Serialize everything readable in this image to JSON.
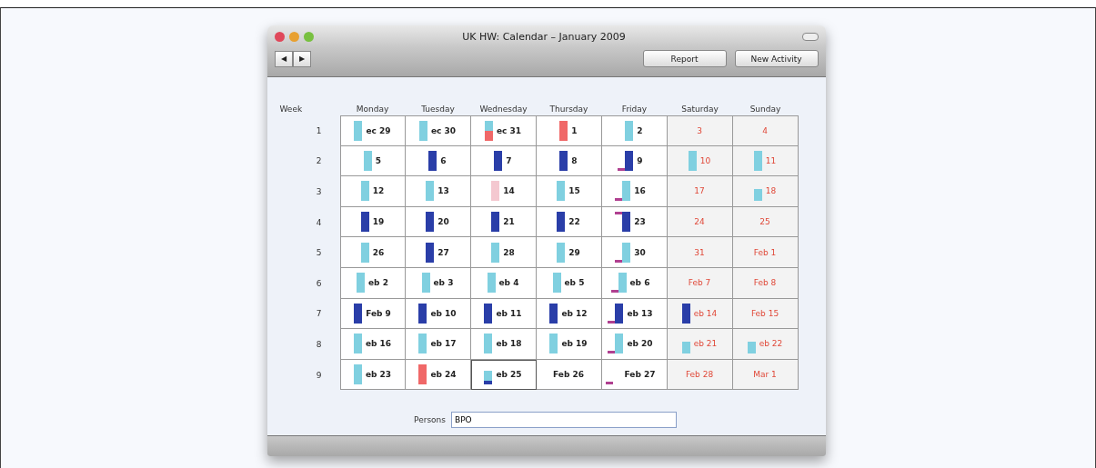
{
  "window": {
    "title": "UK HW: Calendar – January 2009"
  },
  "toolbar": {
    "nav": [
      "◀",
      "▶"
    ],
    "buttons": [
      "Report",
      "New Activity"
    ]
  },
  "calendar": {
    "week_heading": "Week",
    "days": [
      {
        "label": "Monday"
      },
      {
        "label": "Tuesday"
      },
      {
        "label": "Wednesday"
      },
      {
        "label": "Thursday"
      },
      {
        "label": "Friday"
      },
      {
        "label": "Saturday"
      },
      {
        "label": "Sunday"
      }
    ],
    "weeks": [
      {
        "number": "1",
        "cells": [
          {
            "label": "ec 29",
            "weekend": false,
            "selected": false,
            "bars": [
              {
                "kind": "full",
                "color": "#80d0e0"
              }
            ]
          },
          {
            "label": "ec 30",
            "weekend": false,
            "selected": false,
            "bars": [
              {
                "kind": "full",
                "color": "#80d0e0"
              }
            ]
          },
          {
            "label": "ec 31",
            "weekend": false,
            "selected": false,
            "bars": [
              {
                "kind": "half",
                "color": "#f06868"
              },
              {
                "kind": "half",
                "color": "#80d0e0"
              }
            ]
          },
          {
            "label": "1",
            "weekend": false,
            "selected": false,
            "bars": [
              {
                "kind": "full",
                "color": "#f06868"
              }
            ]
          },
          {
            "label": "2",
            "weekend": false,
            "selected": false,
            "bars": [
              {
                "kind": "full",
                "color": "#80d0e0"
              }
            ]
          },
          {
            "label": "3",
            "weekend": true,
            "selected": false
          },
          {
            "label": "4",
            "weekend": true,
            "selected": false
          }
        ]
      },
      {
        "number": "2",
        "cells": [
          {
            "label": "5",
            "weekend": false,
            "selected": false,
            "bars": [
              {
                "kind": "full",
                "color": "#80d0e0"
              }
            ]
          },
          {
            "label": "6",
            "weekend": false,
            "selected": false,
            "bars": [
              {
                "kind": "full",
                "color": "#2a3ea8"
              }
            ]
          },
          {
            "label": "7",
            "weekend": false,
            "selected": false,
            "bars": [
              {
                "kind": "full",
                "color": "#2a3ea8"
              }
            ]
          },
          {
            "label": "8",
            "weekend": false,
            "selected": false,
            "bars": [
              {
                "kind": "full",
                "color": "#2a3ea8"
              }
            ]
          },
          {
            "label": "9",
            "weekend": false,
            "selected": false,
            "markers": [
              {
                "kind": "low"
              }
            ],
            "bars": [
              {
                "kind": "full",
                "color": "#2a3ea8"
              }
            ]
          },
          {
            "label": "10",
            "weekend": true,
            "selected": false,
            "bars": [
              {
                "kind": "full",
                "color": "#80d0e0"
              }
            ]
          },
          {
            "label": "11",
            "weekend": true,
            "selected": false,
            "bars": [
              {
                "kind": "full",
                "color": "#80d0e0"
              }
            ]
          }
        ]
      },
      {
        "number": "3",
        "cells": [
          {
            "label": "12",
            "weekend": false,
            "selected": false,
            "bars": [
              {
                "kind": "full",
                "color": "#80d0e0"
              }
            ]
          },
          {
            "label": "13",
            "weekend": false,
            "selected": false,
            "bars": [
              {
                "kind": "full",
                "color": "#80d0e0"
              }
            ]
          },
          {
            "label": "14",
            "weekend": false,
            "selected": false,
            "bars": [
              {
                "kind": "full",
                "color": "#f4c8d0"
              }
            ]
          },
          {
            "label": "15",
            "weekend": false,
            "selected": false,
            "bars": [
              {
                "kind": "full",
                "color": "#80d0e0"
              }
            ]
          },
          {
            "label": "16",
            "weekend": false,
            "selected": false,
            "markers": [
              {
                "kind": "low"
              }
            ],
            "bars": [
              {
                "kind": "full",
                "color": "#80d0e0"
              }
            ]
          },
          {
            "label": "17",
            "weekend": true,
            "selected": false
          },
          {
            "label": "18",
            "weekend": true,
            "selected": false,
            "bars": [
              {
                "kind": "short",
                "color": "#80d0e0"
              }
            ]
          }
        ]
      },
      {
        "number": "4",
        "cells": [
          {
            "label": "19",
            "weekend": false,
            "selected": false,
            "bars": [
              {
                "kind": "full",
                "color": "#2a3ea8"
              }
            ]
          },
          {
            "label": "20",
            "weekend": false,
            "selected": false,
            "bars": [
              {
                "kind": "full",
                "color": "#2a3ea8"
              }
            ]
          },
          {
            "label": "21",
            "weekend": false,
            "selected": false,
            "bars": [
              {
                "kind": "full",
                "color": "#2a3ea8"
              }
            ]
          },
          {
            "label": "22",
            "weekend": false,
            "selected": false,
            "bars": [
              {
                "kind": "full",
                "color": "#2a3ea8"
              }
            ]
          },
          {
            "label": "23",
            "weekend": false,
            "selected": false,
            "markers": [
              {
                "kind": "high"
              }
            ],
            "bars": [
              {
                "kind": "full",
                "color": "#2a3ea8"
              }
            ]
          },
          {
            "label": "24",
            "weekend": true,
            "selected": false
          },
          {
            "label": "25",
            "weekend": true,
            "selected": false
          }
        ]
      },
      {
        "number": "5",
        "cells": [
          {
            "label": "26",
            "weekend": false,
            "selected": false,
            "bars": [
              {
                "kind": "full",
                "color": "#80d0e0"
              }
            ]
          },
          {
            "label": "27",
            "weekend": false,
            "selected": false,
            "bars": [
              {
                "kind": "full",
                "color": "#2a3ea8"
              }
            ]
          },
          {
            "label": "28",
            "weekend": false,
            "selected": false,
            "bars": [
              {
                "kind": "full",
                "color": "#80d0e0"
              }
            ]
          },
          {
            "label": "29",
            "weekend": false,
            "selected": false,
            "bars": [
              {
                "kind": "full",
                "color": "#80d0e0"
              }
            ]
          },
          {
            "label": "30",
            "weekend": false,
            "selected": false,
            "markers": [
              {
                "kind": "low"
              }
            ],
            "bars": [
              {
                "kind": "full",
                "color": "#80d0e0"
              }
            ]
          },
          {
            "label": "31",
            "weekend": true,
            "selected": false
          },
          {
            "label": "Feb 1",
            "weekend": true,
            "selected": false
          }
        ]
      },
      {
        "number": "6",
        "cells": [
          {
            "label": "eb 2",
            "weekend": false,
            "selected": false,
            "bars": [
              {
                "kind": "full",
                "color": "#80d0e0"
              }
            ]
          },
          {
            "label": "eb 3",
            "weekend": false,
            "selected": false,
            "bars": [
              {
                "kind": "full",
                "color": "#80d0e0"
              }
            ]
          },
          {
            "label": "eb 4",
            "weekend": false,
            "selected": false,
            "bars": [
              {
                "kind": "full",
                "color": "#80d0e0"
              }
            ]
          },
          {
            "label": "eb 5",
            "weekend": false,
            "selected": false,
            "bars": [
              {
                "kind": "full",
                "color": "#80d0e0"
              }
            ]
          },
          {
            "label": "eb 6",
            "weekend": false,
            "selected": false,
            "markers": [
              {
                "kind": "low"
              }
            ],
            "bars": [
              {
                "kind": "full",
                "color": "#80d0e0"
              }
            ]
          },
          {
            "label": "Feb 7",
            "weekend": true,
            "selected": false
          },
          {
            "label": "Feb 8",
            "weekend": true,
            "selected": false
          }
        ]
      },
      {
        "number": "7",
        "cells": [
          {
            "label": "Feb 9",
            "weekend": false,
            "selected": false,
            "bars": [
              {
                "kind": "full",
                "color": "#2a3ea8"
              }
            ]
          },
          {
            "label": "eb 10",
            "weekend": false,
            "selected": false,
            "bars": [
              {
                "kind": "full",
                "color": "#2a3ea8"
              }
            ]
          },
          {
            "label": "eb 11",
            "weekend": false,
            "selected": false,
            "bars": [
              {
                "kind": "full",
                "color": "#2a3ea8"
              }
            ]
          },
          {
            "label": "eb 12",
            "weekend": false,
            "selected": false,
            "bars": [
              {
                "kind": "full",
                "color": "#2a3ea8"
              }
            ]
          },
          {
            "label": "eb 13",
            "weekend": false,
            "selected": false,
            "markers": [
              {
                "kind": "low"
              }
            ],
            "bars": [
              {
                "kind": "full",
                "color": "#2a3ea8"
              }
            ]
          },
          {
            "label": "eb 14",
            "weekend": true,
            "selected": false,
            "bars": [
              {
                "kind": "full",
                "color": "#2a3ea8"
              }
            ]
          },
          {
            "label": "Feb 15",
            "weekend": true,
            "selected": false
          }
        ]
      },
      {
        "number": "8",
        "cells": [
          {
            "label": "eb 16",
            "weekend": false,
            "selected": false,
            "bars": [
              {
                "kind": "full",
                "color": "#80d0e0"
              }
            ]
          },
          {
            "label": "eb 17",
            "weekend": false,
            "selected": false,
            "bars": [
              {
                "kind": "full",
                "color": "#80d0e0"
              }
            ]
          },
          {
            "label": "eb 18",
            "weekend": false,
            "selected": false,
            "bars": [
              {
                "kind": "full",
                "color": "#80d0e0"
              }
            ]
          },
          {
            "label": "eb 19",
            "weekend": false,
            "selected": false,
            "bars": [
              {
                "kind": "full",
                "color": "#80d0e0"
              }
            ]
          },
          {
            "label": "eb 20",
            "weekend": false,
            "selected": false,
            "markers": [
              {
                "kind": "low"
              }
            ],
            "bars": [
              {
                "kind": "full",
                "color": "#80d0e0"
              }
            ]
          },
          {
            "label": "eb 21",
            "weekend": true,
            "selected": false,
            "bars": [
              {
                "kind": "short",
                "color": "#80d0e0"
              }
            ]
          },
          {
            "label": "eb 22",
            "weekend": true,
            "selected": false,
            "bars": [
              {
                "kind": "short",
                "color": "#80d0e0"
              }
            ]
          }
        ]
      },
      {
        "number": "9",
        "cells": [
          {
            "label": "eb 23",
            "weekend": false,
            "selected": false,
            "bars": [
              {
                "kind": "full",
                "color": "#80d0e0"
              }
            ]
          },
          {
            "label": "eb 24",
            "weekend": false,
            "selected": false,
            "bars": [
              {
                "kind": "full",
                "color": "#f06868"
              }
            ]
          },
          {
            "label": "eb 25",
            "weekend": false,
            "selected": true,
            "bars": [
              {
                "kind": "sliver",
                "color": "#2a3ea8"
              },
              {
                "kind": "half",
                "color": "#80d0e0"
              }
            ]
          },
          {
            "label": "Feb 26",
            "weekend": false,
            "selected": false
          },
          {
            "label": "Feb 27",
            "weekend": false,
            "selected": false,
            "markers": [
              {
                "kind": "low"
              }
            ]
          },
          {
            "label": "Feb 28",
            "weekend": true,
            "selected": false
          },
          {
            "label": "Mar 1",
            "weekend": true,
            "selected": false
          }
        ]
      }
    ]
  },
  "persons": {
    "label": "Persons",
    "value": "BPO"
  }
}
